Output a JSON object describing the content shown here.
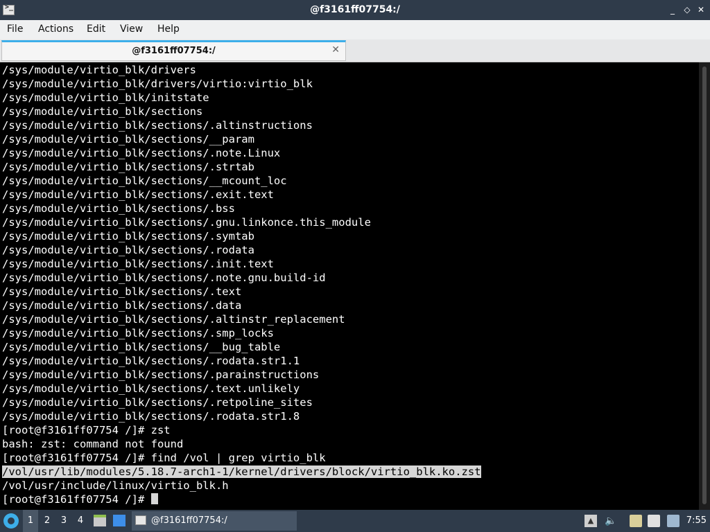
{
  "window": {
    "title": "@f3161ff07754:/",
    "buttons": [
      "_",
      "◇",
      "✕"
    ]
  },
  "menu": [
    "File",
    "Actions",
    "Edit",
    "View",
    "Help"
  ],
  "tab": {
    "title": "@f3161ff07754:/",
    "close": "✕"
  },
  "terminal": {
    "lines": [
      "/sys/module/virtio_blk/drivers",
      "/sys/module/virtio_blk/drivers/virtio:virtio_blk",
      "/sys/module/virtio_blk/initstate",
      "/sys/module/virtio_blk/sections",
      "/sys/module/virtio_blk/sections/.altinstructions",
      "/sys/module/virtio_blk/sections/__param",
      "/sys/module/virtio_blk/sections/.note.Linux",
      "/sys/module/virtio_blk/sections/.strtab",
      "/sys/module/virtio_blk/sections/__mcount_loc",
      "/sys/module/virtio_blk/sections/.exit.text",
      "/sys/module/virtio_blk/sections/.bss",
      "/sys/module/virtio_blk/sections/.gnu.linkonce.this_module",
      "/sys/module/virtio_blk/sections/.symtab",
      "/sys/module/virtio_blk/sections/.rodata",
      "/sys/module/virtio_blk/sections/.init.text",
      "/sys/module/virtio_blk/sections/.note.gnu.build-id",
      "/sys/module/virtio_blk/sections/.text",
      "/sys/module/virtio_blk/sections/.data",
      "/sys/module/virtio_blk/sections/.altinstr_replacement",
      "/sys/module/virtio_blk/sections/.smp_locks",
      "/sys/module/virtio_blk/sections/__bug_table",
      "/sys/module/virtio_blk/sections/.rodata.str1.1",
      "/sys/module/virtio_blk/sections/.parainstructions",
      "/sys/module/virtio_blk/sections/.text.unlikely",
      "/sys/module/virtio_blk/sections/.retpoline_sites",
      "/sys/module/virtio_blk/sections/.rodata.str1.8",
      "[root@f3161ff07754 /]# zst",
      "bash: zst: command not found",
      "[root@f3161ff07754 /]# find /vol | grep virtio_blk",
      "/vol/usr/lib/modules/5.18.7-arch1-1/kernel/drivers/block/virtio_blk.ko.zst",
      "/vol/usr/include/linux/virtio_blk.h"
    ],
    "selected_line_index": 29,
    "prompt": "[root@f3161ff07754 /]# "
  },
  "taskbar": {
    "workspaces": [
      "1",
      "2",
      "3",
      "4"
    ],
    "active_workspace": "1",
    "task_title": "@f3161ff07754:/",
    "clock": "7:55"
  },
  "colors": {
    "titlebar_bg": "#2f3b4a",
    "accent": "#3daee9",
    "terminal_bg": "#000000",
    "terminal_fg": "#ffffff",
    "selection_bg": "#d6d6d6"
  }
}
